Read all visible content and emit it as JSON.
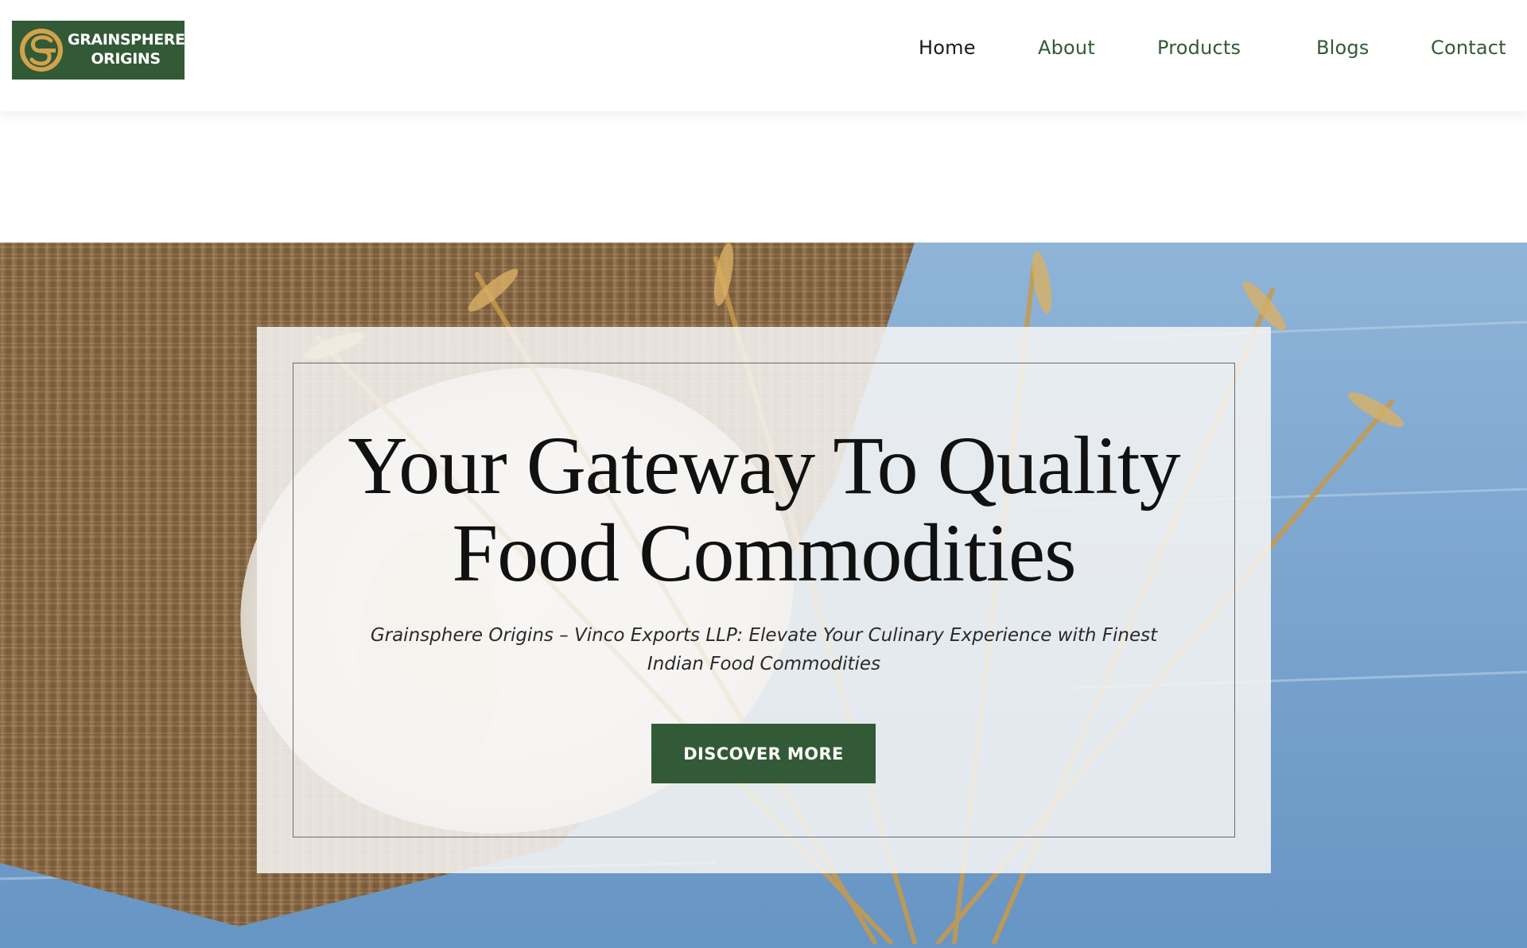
{
  "brand": {
    "name_line1": "GRAINSPHERE",
    "name_line2": "ORIGINS",
    "logo_icon": "gs-monogram-icon",
    "colors": {
      "primary_green": "#335a36",
      "gold": "#d2a24c"
    }
  },
  "nav": {
    "items": [
      {
        "label": "Home",
        "active": true
      },
      {
        "label": "About",
        "active": false
      },
      {
        "label": "Products",
        "active": false
      },
      {
        "label": "Blogs",
        "active": false
      },
      {
        "label": "Contact",
        "active": false
      }
    ]
  },
  "hero": {
    "title_line1": "Your Gateway To Quality",
    "title_line2": "Food Commodities",
    "subtitle": "Grainsphere Origins – Vinco Exports LLP: Elevate Your Culinary Experience with Finest Indian Food Commodities",
    "cta_label": "DISCOVER MORE"
  }
}
